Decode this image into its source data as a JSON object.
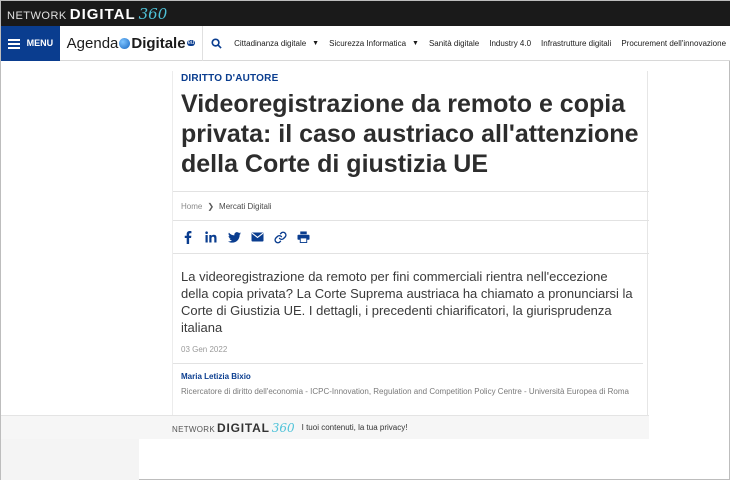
{
  "network_logo": {
    "network": "NETWORK",
    "digital": "DIGITAL",
    "num": "360"
  },
  "nav": {
    "menu_label": "MENU",
    "site_logo": {
      "agenda": "Agenda",
      "digitale": "Digitale",
      "eu": "eu"
    },
    "items": [
      {
        "label": "Cittadinanza digitale",
        "has_dropdown": true
      },
      {
        "label": "Sicurezza Informatica",
        "has_dropdown": true
      },
      {
        "label": "Sanità digitale",
        "has_dropdown": false
      },
      {
        "label": "Industry 4.0",
        "has_dropdown": false
      },
      {
        "label": "Infrastrutture digitali",
        "has_dropdown": false
      },
      {
        "label": "Procurement dell'innovazione",
        "has_dropdown": false
      }
    ]
  },
  "article": {
    "category": "DIRITTO D'AUTORE",
    "title": "Videoregistrazione da remoto e copia privata: il caso austriaco all'attenzione della Corte di giustizia UE",
    "breadcrumb": {
      "home": "Home",
      "current": "Mercati Digitali"
    },
    "share_icons": [
      "facebook-icon",
      "linkedin-icon",
      "twitter-icon",
      "email-icon",
      "link-icon",
      "print-icon"
    ],
    "lead": "La videoregistrazione da remoto per fini commerciali rientra nell'eccezione della copia privata? La Corte Suprema austriaca ha chiamato a pronunciarsi la Corte di Giustizia UE. I dettagli, i precedenti chiarificatori, la giurisprudenza italiana",
    "date": "03 Gen 2022",
    "author": {
      "name": "Maria Letizia Bixio",
      "role": "Ricercatore di diritto dell'economia - ICPC-Innovation, Regulation and Competition Policy Centre - Università Europea di Roma"
    }
  },
  "footer": {
    "logo": {
      "network": "NETWORK",
      "digital": "DIGITAL",
      "num": "360"
    },
    "privacy_text": "I tuoi contenuti, la tua privacy!"
  },
  "colors": {
    "brand_blue": "#0a3d8f",
    "topbar": "#1a1a1a",
    "accent_teal": "#4fc3d9"
  }
}
